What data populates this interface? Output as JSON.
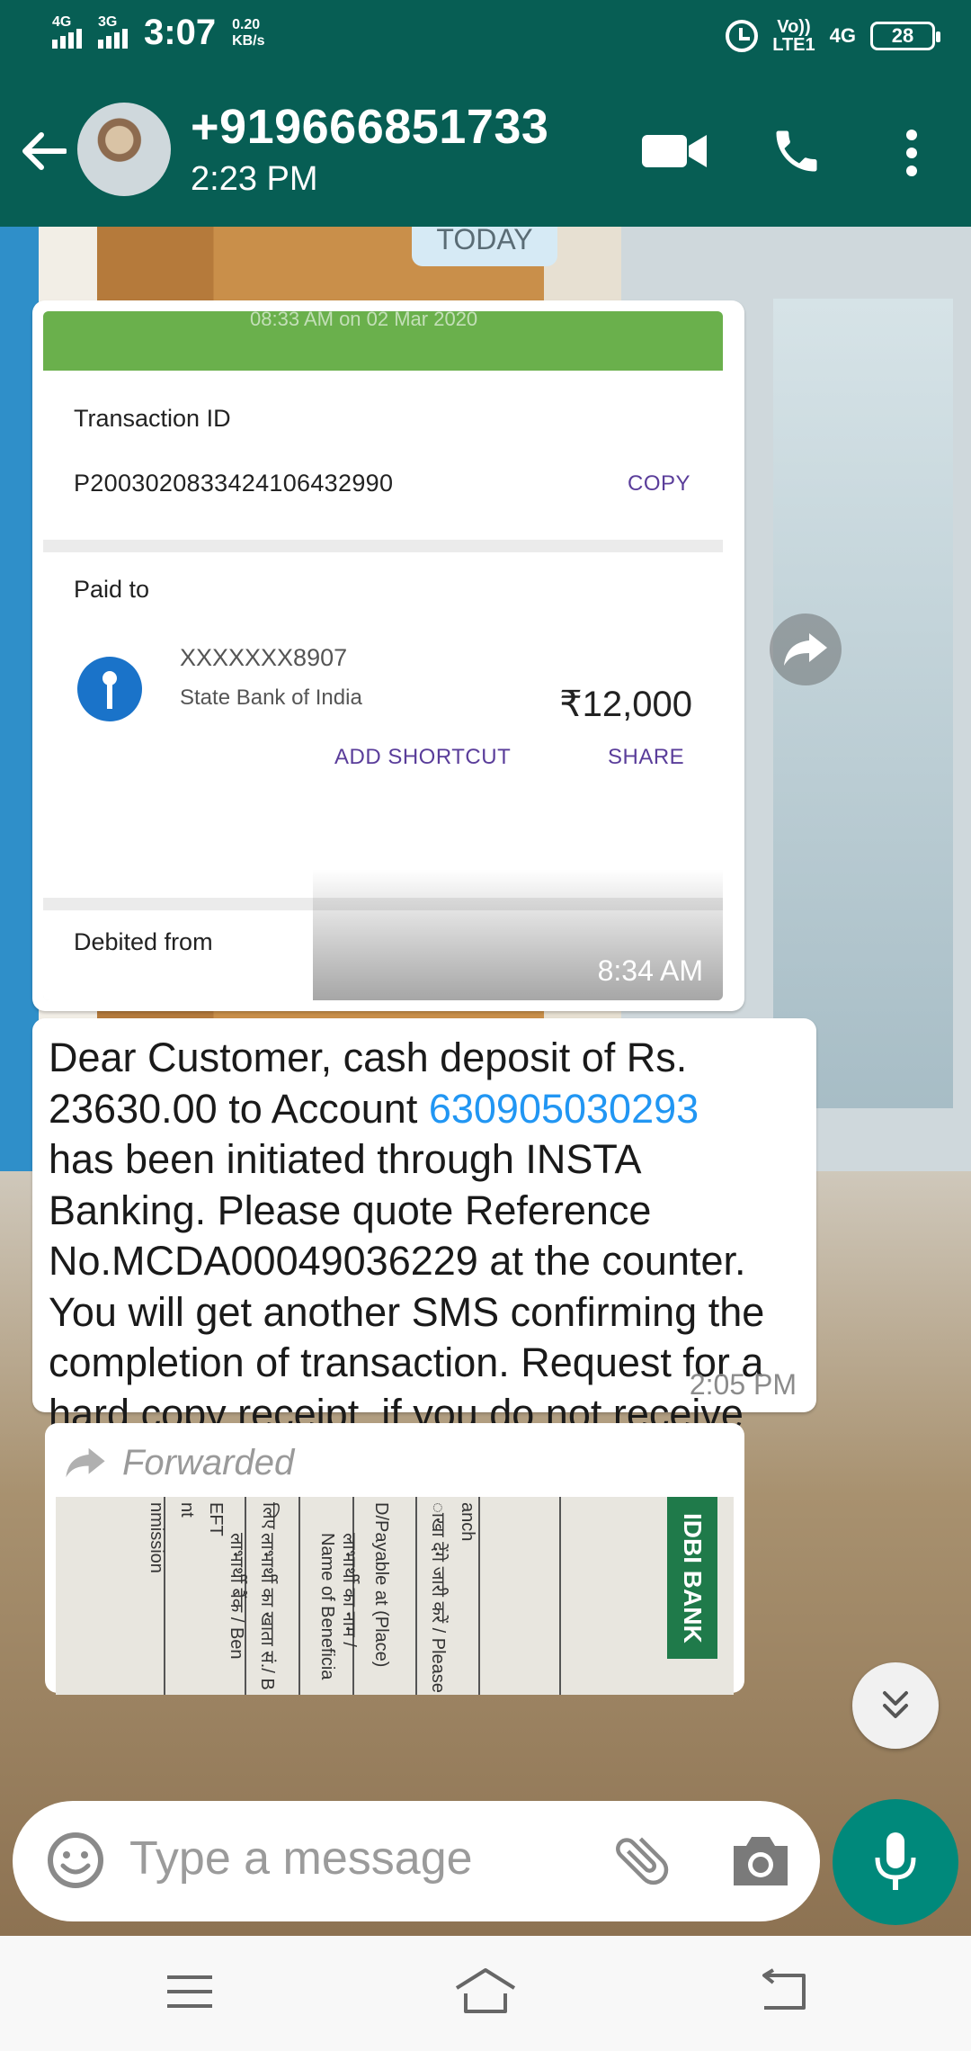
{
  "status_bar": {
    "sim1": "4G",
    "sim2": "3G",
    "time": "3:07",
    "speed_value": "0.20",
    "speed_unit": "KB/s",
    "volte_top": "Vo))",
    "volte_bottom": "LTE1",
    "network": "4G",
    "battery": "28"
  },
  "header": {
    "contact_name": "+919666851733",
    "subtitle": "2:23 PM",
    "icons": [
      "back-arrow-icon",
      "video-call-icon",
      "phone-icon",
      "more-vert-icon"
    ]
  },
  "chat": {
    "date_chip": "TODAY",
    "image_message": {
      "time": "8:34 AM",
      "screenshot": {
        "header_faded": "08:33 AM on 02 Mar 2020",
        "transaction_label": "Transaction ID",
        "transaction_id": "P2003020833424106432990",
        "copy": "COPY",
        "paid_to_label": "Paid to",
        "account": "XXXXXXX8907",
        "bank": "State Bank of India",
        "amount": "₹12,000",
        "add_shortcut": "ADD SHORTCUT",
        "share": "SHARE",
        "debited_label": "Debited from"
      }
    },
    "text_message": {
      "before": "Dear Customer, cash deposit of Rs. 23630.00 to Account ",
      "account_link": "630905030293",
      "after": "\nhas been initiated through INSTA Banking. Please quote Reference No.MCDA00049036229 at the counter. You will get another SMS confirming the completion of transaction. Request for a hard copy receipt, if you do not receive the confirmation SMS.",
      "time": "2:05 PM"
    },
    "forwarded_message": {
      "label": "Forwarded",
      "bank_stamp": "IDBI BANK",
      "doc_texts": [
        "nmission",
        "nt",
        "EFT",
        "लिए",
        "लाभार्थी बैंक / Ben",
        "लाभार्थी का खाता सं./ B",
        "लाभार्थी का नाम / Name of Beneficia",
        "D/Payable at (Place)",
        "ाखा देंगे जारी करें / Please",
        "anch"
      ]
    }
  },
  "input": {
    "placeholder": "Type a message"
  },
  "colors": {
    "primary": "#075e54",
    "mic": "#00897b",
    "link": "#2196f3"
  }
}
